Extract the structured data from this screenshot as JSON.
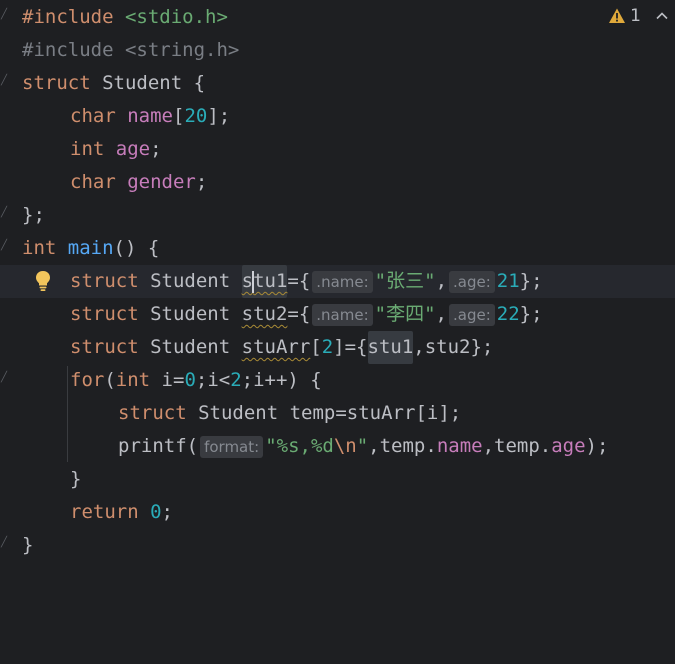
{
  "inspection": {
    "warning_count": "1"
  },
  "code": {
    "l1": {
      "directive": "#include",
      "header": "<stdio.h>"
    },
    "l2": {
      "directive": "#include",
      "header": "<string.h>"
    },
    "l3": {
      "kw": "struct",
      "name": "Student",
      "rest": " {"
    },
    "l4": {
      "type": "char",
      "field": "name",
      "open": "[",
      "size": "20",
      "close": "];"
    },
    "l5": {
      "type": "int",
      "field": "age",
      "end": ";"
    },
    "l6": {
      "type": "char",
      "field": "gender",
      "end": ";"
    },
    "l7": {
      "text": "};"
    },
    "l8": {
      "type": "int",
      "fn": "main",
      "rest": "() {"
    },
    "l9": {
      "kw": "struct",
      "type": "Student",
      "var_a": "s",
      "var_b": "tu1",
      "eq": "={",
      "hint1": ".name:",
      "str": "\"张三\"",
      "comma": ",",
      "hint2": ".age:",
      "num": "21",
      "end": "};"
    },
    "l10": {
      "kw": "struct",
      "type": "Student",
      "var": "stu2",
      "eq": "={",
      "hint1": ".name:",
      "str": "\"李四\"",
      "comma": ",",
      "hint2": ".age:",
      "num": "22",
      "end": "};"
    },
    "l11": {
      "kw": "struct",
      "type": "Student",
      "var": "stuArr",
      "open": "[",
      "num": "2",
      "mid": "]={",
      "a": "stu1",
      "comma": ",",
      "b": "stu2",
      "end": "};"
    },
    "l12": {
      "kw": "for",
      "p1": "(",
      "type": "int",
      "init": " i=",
      "n0": "0",
      "cond": ";i<",
      "n2": "2",
      "rest": ";i++) {"
    },
    "l13": {
      "kw": "struct",
      "type": "Student",
      "rest": " temp=stuArr[i];"
    },
    "l14": {
      "fn": "printf(",
      "hint": "format:",
      "s1": "\"%s,%d",
      "esc": "\\n",
      "s2": "\"",
      "p1": ",temp.",
      "f1": "name",
      "p2": ",temp.",
      "f2": "age",
      "end": ");"
    },
    "l15": {
      "text": "}"
    },
    "l16": {
      "kw": "return",
      "num": "0",
      "end": ";"
    },
    "l17": {
      "text": "}"
    }
  }
}
